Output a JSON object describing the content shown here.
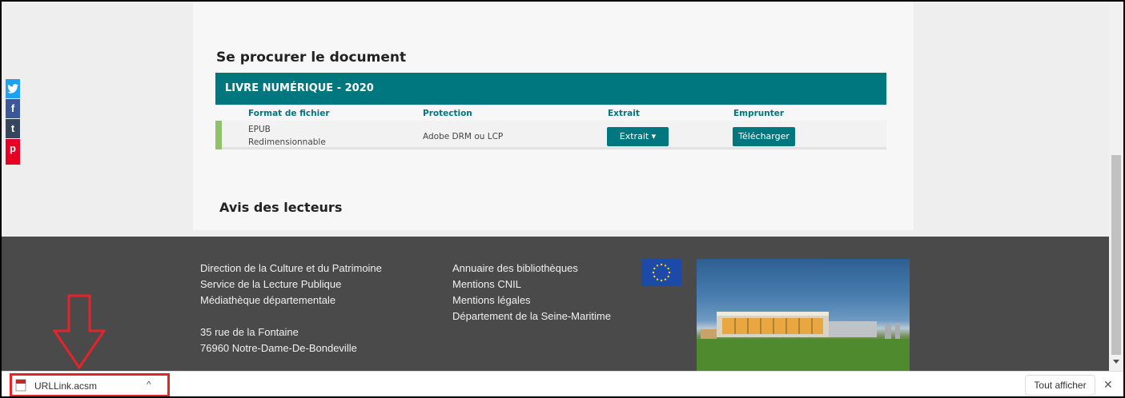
{
  "section_title": "Se procurer le document",
  "ebook": {
    "header": "LIVRE NUMÉRIQUE - 2020",
    "columns": {
      "format": "Format de fichier",
      "protection": "Protection",
      "extract": "Extrait",
      "borrow": "Emprunter"
    },
    "row": {
      "format_line1": "EPUB",
      "format_line2": "Redimensionnable",
      "protection": "Adobe DRM ou LCP",
      "extract_button": "Extrait ▾",
      "download_button": "Télécharger"
    }
  },
  "reviews_title": "Avis des lecteurs",
  "social": {
    "twitter": "t",
    "facebook": "f",
    "tumblr": "t",
    "pinterest": "p"
  },
  "footer": {
    "col1": [
      "Direction de la Culture et du Patrimoine",
      "Service de la Lecture Publique",
      "Médiathèque départementale"
    ],
    "address": [
      "35 rue de la Fontaine",
      "76960 Notre-Dame-De-Bondeville"
    ],
    "col2": [
      "Annuaire des bibliothèques",
      "Mentions CNIL",
      "Mentions légales",
      "Département de la Seine-Maritime"
    ]
  },
  "download_bar": {
    "filename": "URLLink.acsm",
    "chevron": "^",
    "show_all": "Tout afficher",
    "close": "✕"
  },
  "colors": {
    "teal": "#00767e",
    "green_bar": "#8fc26b",
    "footer_bg": "#4a4a4a",
    "annotation_red": "#e4242a"
  }
}
